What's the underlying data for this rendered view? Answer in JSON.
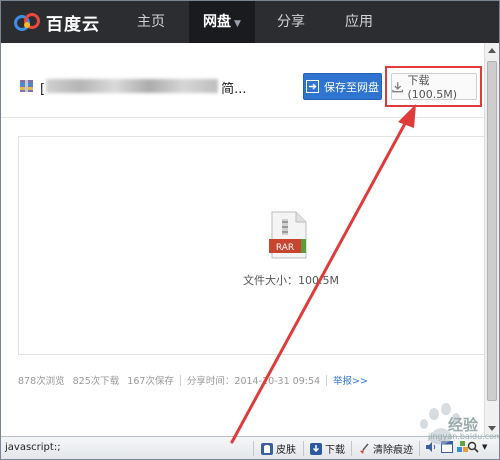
{
  "nav": {
    "logo_text": "百度云",
    "items": [
      {
        "label": "主页"
      },
      {
        "label": "网盘"
      },
      {
        "label": "分享"
      },
      {
        "label": "应用"
      }
    ]
  },
  "file": {
    "name_start": "[",
    "name_end": "简..."
  },
  "actions": {
    "save_label": "保存至网盘",
    "download_label": "下载(100.5M)"
  },
  "preview": {
    "file_type": "RAR",
    "size_text": "文件大小：100.5M"
  },
  "stats": {
    "views": "878次浏览",
    "downloads": "825次下载",
    "saves": "167次保存",
    "share_time": "分享时间：2014-10-31 09:54",
    "report": "举报>>"
  },
  "statusbar": {
    "left": "javascript:;",
    "skin": "皮肤",
    "download": "下载",
    "clear_trace": "清除痕迹"
  },
  "watermark": {
    "text": "经验",
    "url": "jingyan.baidu.com"
  },
  "colors": {
    "nav_bg": "#2b2d31",
    "accent_blue": "#2f74d0",
    "highlight_red": "#e03a3a"
  }
}
